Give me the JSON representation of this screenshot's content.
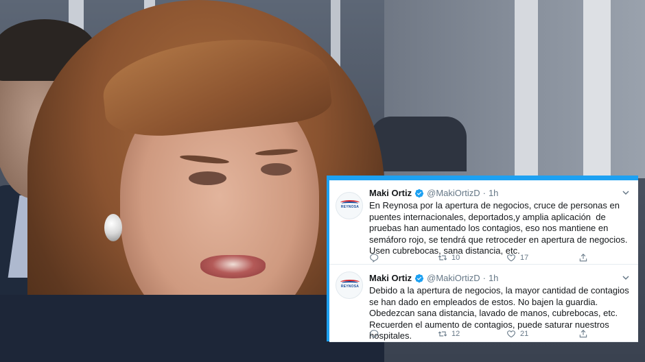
{
  "tweets": [
    {
      "name": "Maki Ortiz",
      "handle": "@MakiOrtizD",
      "time": "1h",
      "avatar_brand": "REYNOSA",
      "text": "En Reynosa por la apertura de negocios, cruce de personas en puentes internacionales, deportados,y amplia aplicación  de pruebas han aumentado los contagios, eso nos mantiene en semáforo rojo, se tendrá que retroceder en apertura de negocios. Usen cubrebocas, sana distancia, etc.",
      "retweets": "10",
      "likes": "17"
    },
    {
      "name": "Maki Ortiz",
      "handle": "@MakiOrtizD",
      "time": "1h",
      "avatar_brand": "REYNOSA",
      "text": "Debido a la apertura de negocios, la mayor cantidad de contagios se han dado en empleados de estos. No bajen la guardia. Obedezcan sana distancia, lavado de manos, cubrebocas, etc. Recuerden el aumento de contagios, puede saturar nuestros hospitales.",
      "retweets": "12",
      "likes": "21"
    }
  ],
  "colors": {
    "twitter_blue": "#1da1f2",
    "text_primary": "#14171a",
    "text_secondary": "#657786"
  },
  "icons": [
    "verified-badge-icon",
    "chevron-down-icon",
    "reply-icon",
    "retweet-icon",
    "like-icon",
    "share-icon"
  ]
}
